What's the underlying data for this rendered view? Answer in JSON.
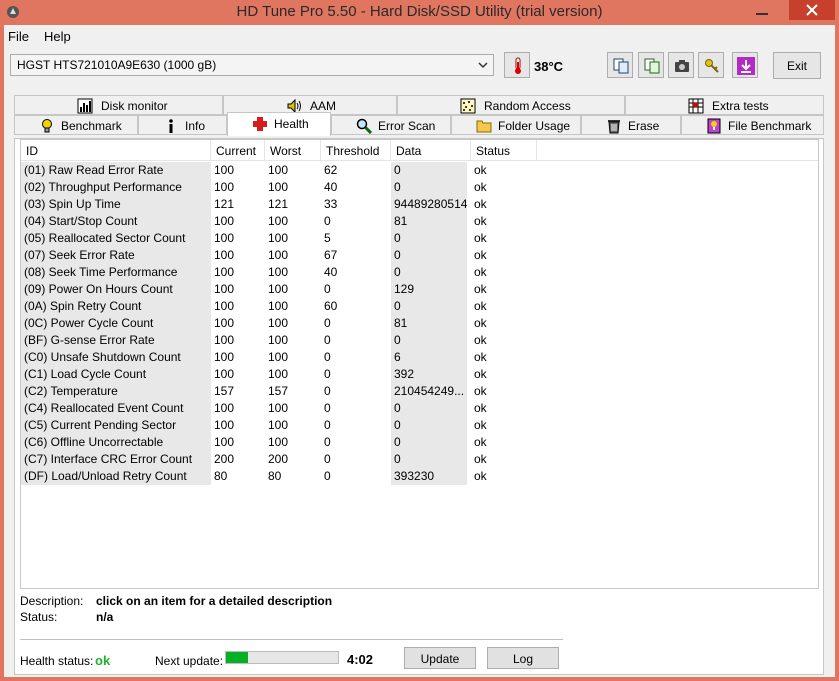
{
  "window": {
    "title": "HD Tune Pro 5.50 - Hard Disk/SSD Utility (trial version)"
  },
  "menu": {
    "file": "File",
    "help": "Help"
  },
  "toolbar": {
    "drive": "HGST HTS721010A9E630 (1000 gB)",
    "temperature": "38°C",
    "exit_label": "Exit"
  },
  "tabs_top": [
    {
      "label": "Disk monitor",
      "icon": "disk-monitor-icon"
    },
    {
      "label": "AAM",
      "icon": "speaker-icon"
    },
    {
      "label": "Random Access",
      "icon": "random-access-icon"
    },
    {
      "label": "Extra tests",
      "icon": "extra-tests-icon"
    }
  ],
  "tabs_bottom": [
    {
      "label": "Benchmark",
      "icon": "lightbulb-icon"
    },
    {
      "label": "Info",
      "icon": "info-icon"
    },
    {
      "label": "Health",
      "icon": "health-cross-icon"
    },
    {
      "label": "Error Scan",
      "icon": "magnifier-icon"
    },
    {
      "label": "Folder Usage",
      "icon": "folder-icon"
    },
    {
      "label": "Erase",
      "icon": "trash-icon"
    },
    {
      "label": "File Benchmark",
      "icon": "file-benchmark-icon"
    }
  ],
  "table": {
    "headers": [
      "ID",
      "Current",
      "Worst",
      "Threshold",
      "Data",
      "Status"
    ],
    "rows": [
      [
        "(01) Raw Read Error Rate",
        "100",
        "100",
        "62",
        "0",
        "ok"
      ],
      [
        "(02) Throughput Performance",
        "100",
        "100",
        "40",
        "0",
        "ok"
      ],
      [
        "(03) Spin Up Time",
        "121",
        "121",
        "33",
        "94489280514",
        "ok"
      ],
      [
        "(04) Start/Stop Count",
        "100",
        "100",
        "0",
        "81",
        "ok"
      ],
      [
        "(05) Reallocated Sector Count",
        "100",
        "100",
        "5",
        "0",
        "ok"
      ],
      [
        "(07) Seek Error Rate",
        "100",
        "100",
        "67",
        "0",
        "ok"
      ],
      [
        "(08) Seek Time Performance",
        "100",
        "100",
        "40",
        "0",
        "ok"
      ],
      [
        "(09) Power On Hours Count",
        "100",
        "100",
        "0",
        "129",
        "ok"
      ],
      [
        "(0A) Spin Retry Count",
        "100",
        "100",
        "60",
        "0",
        "ok"
      ],
      [
        "(0C) Power Cycle Count",
        "100",
        "100",
        "0",
        "81",
        "ok"
      ],
      [
        "(BF) G-sense Error Rate",
        "100",
        "100",
        "0",
        "0",
        "ok"
      ],
      [
        "(C0) Unsafe Shutdown Count",
        "100",
        "100",
        "0",
        "6",
        "ok"
      ],
      [
        "(C1) Load Cycle Count",
        "100",
        "100",
        "0",
        "392",
        "ok"
      ],
      [
        "(C2) Temperature",
        "157",
        "157",
        "0",
        "210454249...",
        "ok"
      ],
      [
        "(C4) Reallocated Event Count",
        "100",
        "100",
        "0",
        "0",
        "ok"
      ],
      [
        "(C5) Current Pending Sector",
        "100",
        "100",
        "0",
        "0",
        "ok"
      ],
      [
        "(C6) Offline Uncorrectable",
        "100",
        "100",
        "0",
        "0",
        "ok"
      ],
      [
        "(C7) Interface CRC Error Count",
        "200",
        "200",
        "0",
        "0",
        "ok"
      ],
      [
        "(DF) Load/Unload Retry Count",
        "80",
        "80",
        "0",
        "393230",
        "ok"
      ]
    ]
  },
  "description": {
    "desc_label": "Description:",
    "desc_value": "click on an item for a detailed description",
    "status_label": "Status:",
    "status_value": "n/a"
  },
  "footer": {
    "health_label": "Health status:",
    "health_value": "ok",
    "next_label": "Next update:",
    "progress_fraction": 0.2,
    "time": "4:02",
    "update_label": "Update",
    "log_label": "Log"
  }
}
